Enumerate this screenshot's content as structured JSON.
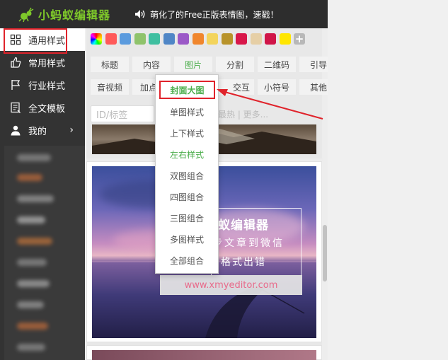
{
  "app": {
    "logo_text": "小蚂蚁编辑器",
    "notice": "萌化了的Free正版表情图，速戳！"
  },
  "sidebar": {
    "items": [
      {
        "label": "通用样式",
        "icon": "grid-icon"
      },
      {
        "label": "常用样式",
        "icon": "thumbs-up-icon"
      },
      {
        "label": "行业样式",
        "icon": "flag-icon"
      },
      {
        "label": "全文模板",
        "icon": "document-icon"
      },
      {
        "label": "我的",
        "icon": "user-icon",
        "arrow": "›"
      }
    ]
  },
  "palette": [
    "#ff5a5a",
    "#5b9bde",
    "#8fc36b",
    "#3fbfa0",
    "#4f86c6",
    "#9b59c7",
    "#f0862d",
    "#f3d45c",
    "#b8932a",
    "#d8174a",
    "#e6cfa6",
    "#d01548",
    "#ffe600"
  ],
  "tabs_row1": [
    "标题",
    "内容",
    "图片",
    "分割",
    "二维码",
    "引导"
  ],
  "tabs_row2": [
    "音视频",
    "加点特效",
    "",
    "互动交互",
    "小符号",
    "其他"
  ],
  "tabs_row2_visible": [
    "音视频",
    "加点",
    "交互",
    "小符号",
    "其他"
  ],
  "search": {
    "placeholder": "ID/标签"
  },
  "filters": "最热 | 更多...",
  "dropdown": {
    "items": [
      "封面大图",
      "单图样式",
      "上下样式",
      "左右样式",
      "双图组合",
      "四图组合",
      "三图组合",
      "多图样式",
      "全部组合"
    ],
    "selected": "封面大图",
    "highlight": "左右样式"
  },
  "preview": {
    "title": "蚁编辑器",
    "line1": "步文章到微信",
    "line2": "格式出错",
    "url": "www.xmyeditor.com"
  }
}
